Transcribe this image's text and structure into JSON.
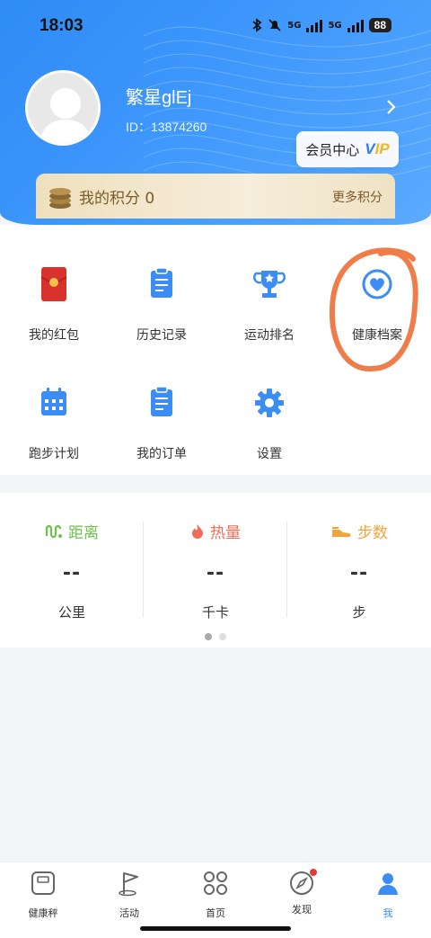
{
  "status_bar": {
    "time": "18:03",
    "signal1_label": "5G",
    "signal2_label": "5G",
    "battery": "88"
  },
  "profile": {
    "username": "繁星glEj",
    "id_text": "ID：13874260"
  },
  "vip": {
    "label": "会员中心",
    "badge_v": "V",
    "badge_ip": "IP"
  },
  "points": {
    "label": "我的积分 0",
    "more": "更多积分"
  },
  "grid": {
    "items": [
      {
        "label": "我的红包",
        "icon": "red-envelope-icon"
      },
      {
        "label": "历史记录",
        "icon": "clipboard-icon"
      },
      {
        "label": "运动排名",
        "icon": "trophy-icon"
      },
      {
        "label": "健康档案",
        "icon": "heart-icon"
      },
      {
        "label": "跑步计划",
        "icon": "calendar-icon"
      },
      {
        "label": "我的订单",
        "icon": "order-clipboard-icon"
      },
      {
        "label": "设置",
        "icon": "gear-icon"
      }
    ]
  },
  "stats": [
    {
      "title": "距离",
      "value": "--",
      "unit": "公里",
      "color": "#6cc24a",
      "icon": "route-icon"
    },
    {
      "title": "热量",
      "value": "--",
      "unit": "千卡",
      "color": "#f06d5a",
      "icon": "flame-icon"
    },
    {
      "title": "步数",
      "value": "--",
      "unit": "步",
      "color": "#f2a33a",
      "icon": "shoe-icon"
    }
  ],
  "tabs": [
    {
      "label": "健康秤",
      "icon": "scale-icon"
    },
    {
      "label": "活动",
      "icon": "flag-icon"
    },
    {
      "label": "首页",
      "icon": "grid-icon"
    },
    {
      "label": "发现",
      "icon": "compass-icon"
    },
    {
      "label": "我",
      "icon": "person-icon"
    }
  ],
  "colors": {
    "primary": "#3b8cf5",
    "header_blue": "#3c96fb",
    "gold_text": "#7a5b2a",
    "annotation": "#ef7d4a"
  }
}
